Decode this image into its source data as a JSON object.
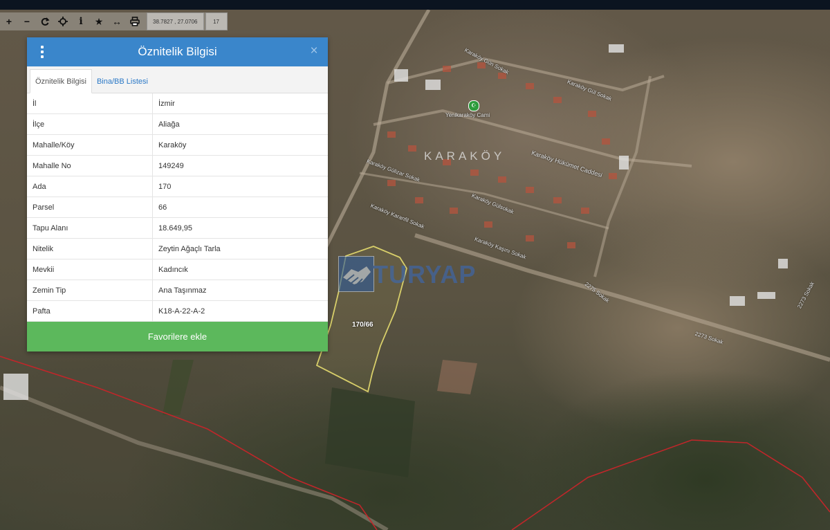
{
  "toolbar": {
    "icons": [
      "plus-icon",
      "minus-icon",
      "refresh-icon",
      "crosshair-icon",
      "info-icon",
      "star-icon",
      "measure-icon",
      "print-icon"
    ],
    "zoom_in": "+",
    "zoom_out": "−",
    "info": "i",
    "star": "★",
    "measure": "↔",
    "coordinates": "38.7827 , 27.0706",
    "zoom_level": "17"
  },
  "panel": {
    "title": "Öznitelik Bilgisi",
    "close": "×",
    "tabs": [
      {
        "label": "Öznitelik Bilgisi",
        "active": true
      },
      {
        "label": "Bina/BB Listesi",
        "active": false
      }
    ],
    "rows": [
      {
        "key": "İl",
        "value": "İzmir"
      },
      {
        "key": "İlçe",
        "value": "Aliağa"
      },
      {
        "key": "Mahalle/Köy",
        "value": "Karaköy"
      },
      {
        "key": "Mahalle No",
        "value": "149249"
      },
      {
        "key": "Ada",
        "value": "170"
      },
      {
        "key": "Parsel",
        "value": "66"
      },
      {
        "key": "Tapu Alanı",
        "value": "18.649,95"
      },
      {
        "key": "Nitelik",
        "value": "Zeytin Ağaçlı Tarla"
      },
      {
        "key": "Mevkii",
        "value": "Kadıncık"
      },
      {
        "key": "Zemin Tip",
        "value": "Ana Taşınmaz"
      },
      {
        "key": "Pafta",
        "value": "K18-A-22-A-2"
      }
    ],
    "favorite_button": "Favorilere ekle"
  },
  "map": {
    "village_label": "KARAKÖY",
    "parcel_label": "170/66",
    "watermark": "TURYAP",
    "mosque_label": "Yenikaraköy Cami",
    "street_labels": [
      "Karaköy Gün Sokak",
      "Karaköy Gül Sokak",
      "Karaköy Gülizar Sokak",
      "Karaköy Hükümet Caddesi",
      "Karaköy Gülsokak",
      "Karaköy Karanfil Sokak",
      "Karaköy Kaşını Sokak",
      "2275 Sokak",
      "2273 Sokak",
      "2273 Sokak"
    ],
    "colors": {
      "parcel_outline": "#d8cf6a",
      "boundary": "#c0262a",
      "panel_header": "#3a86cb",
      "favorite": "#5cb85c"
    }
  }
}
